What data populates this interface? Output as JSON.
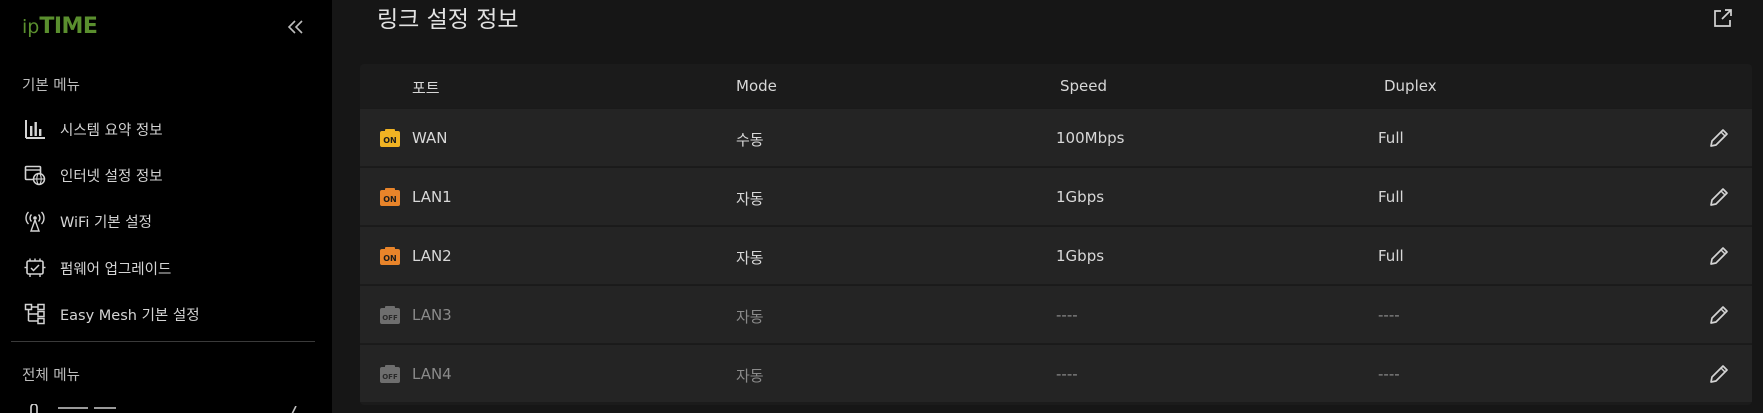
{
  "sidebar": {
    "logo_small": "ip",
    "logo_big": "TIME",
    "section_basic": "기본 메뉴",
    "items": [
      {
        "label": "시스템 요약 정보",
        "icon": "bar-chart-icon"
      },
      {
        "label": "인터넷 설정 정보",
        "icon": "globe-window-icon"
      },
      {
        "label": "WiFi 기본 설정",
        "icon": "wifi-antenna-icon"
      },
      {
        "label": "펌웨어 업그레이드",
        "icon": "firmware-upgrade-icon"
      },
      {
        "label": "Easy Mesh 기본 설정",
        "icon": "mesh-tree-icon"
      }
    ],
    "section_all": "전체 메뉴"
  },
  "main": {
    "title": "링크 설정 정보",
    "columns": [
      "포트",
      "Mode",
      "Speed",
      "Duplex"
    ],
    "rows": [
      {
        "port": "WAN",
        "status": "ON",
        "mode": "수동",
        "speed": "100Mbps",
        "duplex": "Full"
      },
      {
        "port": "LAN1",
        "status": "ON",
        "mode": "자동",
        "speed": "1Gbps",
        "duplex": "Full"
      },
      {
        "port": "LAN2",
        "status": "ON",
        "mode": "자동",
        "speed": "1Gbps",
        "duplex": "Full"
      },
      {
        "port": "LAN3",
        "status": "OFF",
        "mode": "자동",
        "speed": "----",
        "duplex": "----"
      },
      {
        "port": "LAN4",
        "status": "OFF",
        "mode": "자동",
        "speed": "----",
        "duplex": "----"
      }
    ]
  },
  "colors": {
    "logo_green": "#5a8f2e",
    "wan_on": "#f0b323",
    "lan_on": "#e8842a",
    "port_off": "#6e6e6e",
    "sidebar_bg": "#000000",
    "main_bg": "#161616",
    "row_bg": "#242424"
  }
}
